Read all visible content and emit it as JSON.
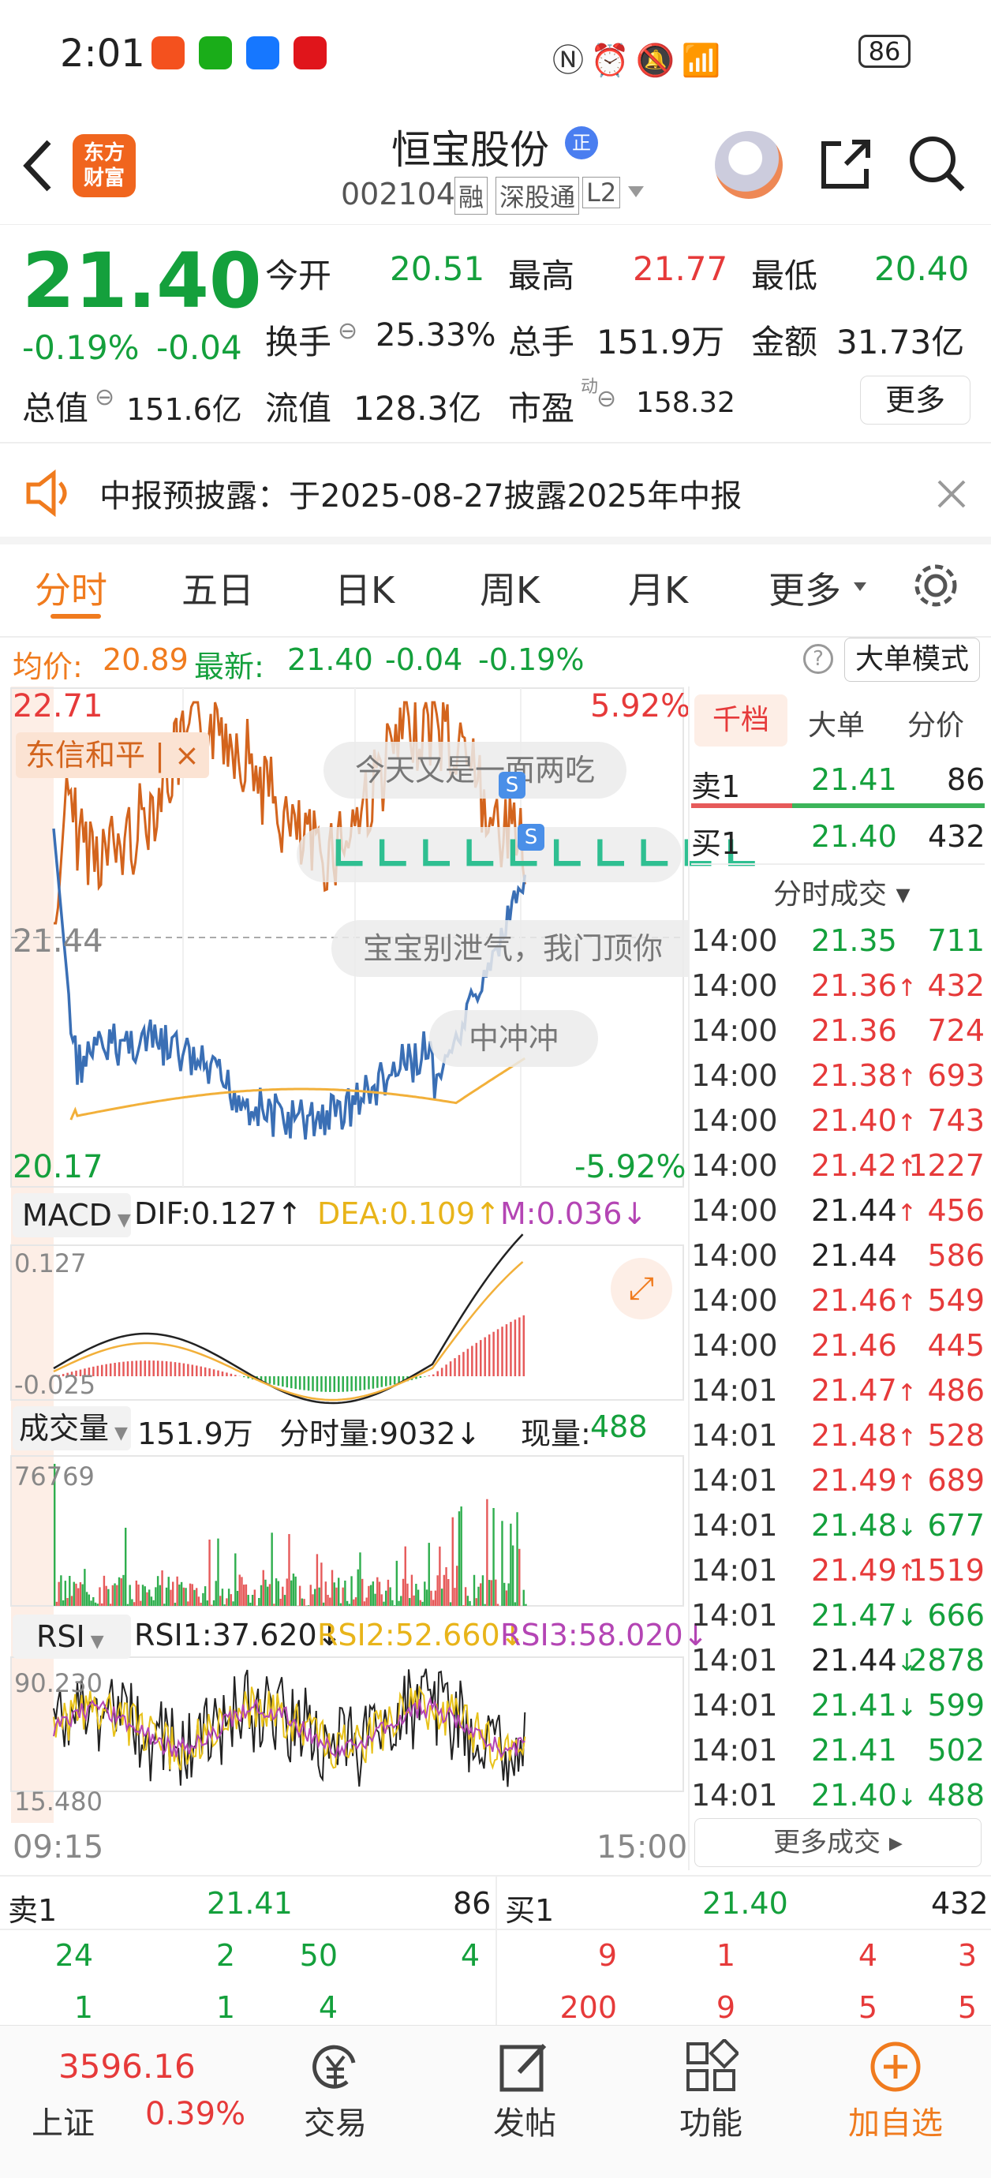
{
  "status": {
    "time": "2:01",
    "battery": "86"
  },
  "header": {
    "title": "恒宝股份",
    "title_badge": "正",
    "code": "002104",
    "tags": [
      "融",
      "深股通",
      "L2"
    ],
    "logo": "东方\n财富"
  },
  "quote": {
    "price": "21.40",
    "change_pct": "-0.19%",
    "change": "-0.04",
    "open_label": "今开",
    "open": "20.51",
    "high_label": "最高",
    "high": "21.77",
    "low_label": "最低",
    "low": "20.40",
    "turnover_label": "换手",
    "turnover": "25.33%",
    "vol_label": "总手",
    "vol": "151.9万",
    "amount_label": "金额",
    "amount": "31.73亿",
    "mcap_label": "总值",
    "mcap": "151.6亿",
    "float_label": "流值",
    "float": "128.3亿",
    "pe_label": "市盈",
    "pe_sup": "动",
    "pe": "158.32",
    "more": "更多"
  },
  "notice": {
    "text": "中报预披露：于2025-08-27披露2025年中报"
  },
  "tabs": [
    "分时",
    "五日",
    "日K",
    "周K",
    "月K",
    "更多"
  ],
  "summary": {
    "avg_label": "均价:",
    "avg": "20.89",
    "latest_label": "最新:",
    "latest": "21.40",
    "chg": "-0.04",
    "pct": "-0.19%",
    "mode": "大单模式"
  },
  "chart": {
    "top_price": "22.71",
    "top_pct": "5.92%",
    "mid_price": "21.44",
    "bot_price": "20.17",
    "bot_pct": "-5.92%",
    "overlay": "东信和平 | ×",
    "start_time": "09:15",
    "end_time": "15:00",
    "danmu": [
      "今天又是一面两吃",
      "宝宝别泄气，我门顶你",
      "中冲冲"
    ]
  },
  "macd": {
    "label": "MACD",
    "dif": "DIF:0.127↑",
    "dea": "DEA:0.109↑",
    "m": "M:0.036↓",
    "top": "0.127",
    "bot": "-0.025"
  },
  "volume": {
    "label": "成交量",
    "total": "151.9万",
    "fs": "分时量:9032↓",
    "now_label": "现量:",
    "now": "488",
    "max": "76769"
  },
  "rsi": {
    "label": "RSI",
    "r1": "RSI1:37.620↓",
    "r2": "RSI2:52.660↓",
    "r3": "RSI3:58.020↓",
    "top": "90.230",
    "bot": "15.480"
  },
  "side": {
    "tabs": [
      "千档",
      "大单",
      "分价"
    ],
    "sell1": {
      "label": "卖1",
      "price": "21.41",
      "vol": "86"
    },
    "buy1": {
      "label": "买1",
      "price": "21.40",
      "vol": "432"
    },
    "trades_title": "分时成交 ▾",
    "more": "更多成交 ▸",
    "trades": [
      [
        "14:00",
        "21.35",
        "711",
        "green",
        ""
      ],
      [
        "14:00",
        "21.36",
        "432",
        "red",
        "↑"
      ],
      [
        "14:00",
        "21.36",
        "724",
        "red",
        ""
      ],
      [
        "14:00",
        "21.38",
        "693",
        "red",
        "↑"
      ],
      [
        "14:00",
        "21.40",
        "743",
        "red",
        "↑"
      ],
      [
        "14:00",
        "21.42",
        "1227",
        "red",
        "↑"
      ],
      [
        "14:00",
        "21.44",
        "456",
        "red",
        "↑"
      ],
      [
        "14:00",
        "21.44",
        "586",
        "red",
        ""
      ],
      [
        "14:00",
        "21.46",
        "549",
        "red",
        "↑"
      ],
      [
        "14:00",
        "21.46",
        "445",
        "red",
        ""
      ],
      [
        "14:01",
        "21.47",
        "486",
        "red",
        "↑"
      ],
      [
        "14:01",
        "21.48",
        "528",
        "red",
        "↑"
      ],
      [
        "14:01",
        "21.49",
        "689",
        "red",
        "↑"
      ],
      [
        "14:01",
        "21.48",
        "677",
        "green",
        "↓"
      ],
      [
        "14:01",
        "21.49",
        "1519",
        "red",
        "↑"
      ],
      [
        "14:01",
        "21.47",
        "666",
        "green",
        "↓"
      ],
      [
        "14:01",
        "21.44",
        "2878",
        "green",
        "↓"
      ],
      [
        "14:01",
        "21.41",
        "599",
        "green",
        "↓"
      ],
      [
        "14:01",
        "21.41",
        "502",
        "green",
        ""
      ],
      [
        "14:01",
        "21.40",
        "488",
        "green",
        "↓"
      ]
    ]
  },
  "bottom_quote": {
    "sell_label": "卖1",
    "sell_price": "21.41",
    "sell_vol": "86",
    "buy_label": "买1",
    "buy_price": "21.40",
    "buy_vol": "432",
    "sell_detail": [
      [
        "24",
        "2",
        "50",
        "4"
      ],
      [
        "1",
        "1",
        "4",
        ""
      ]
    ],
    "buy_detail": [
      [
        "9",
        "1",
        "4",
        "3"
      ],
      [
        "200",
        "9",
        "5",
        "5"
      ]
    ]
  },
  "bottom_nav": {
    "index_value": "3596.16",
    "index_name": "上证",
    "index_pct": "0.39%",
    "items": [
      "交易",
      "发帖",
      "功能",
      "加自选"
    ]
  }
}
